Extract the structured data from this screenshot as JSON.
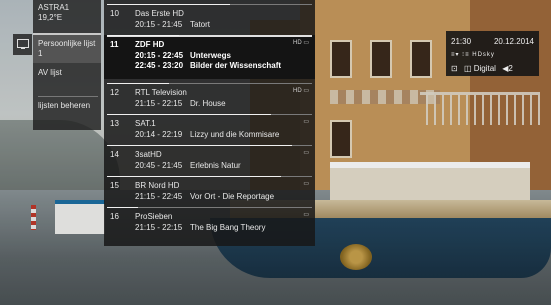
{
  "menu": {
    "satellite_name": "ASTRA1",
    "satellite_position": "19,2°E",
    "items": [
      {
        "label": "Persoonlijke lijst 1",
        "selected": true
      },
      {
        "label": "AV lijst",
        "selected": false
      },
      {
        "label": "lijsten beheren",
        "selected": false
      }
    ],
    "side_icon": "tv-icon"
  },
  "channels": [
    {
      "num": "10",
      "name": "Das Erste HD",
      "lines": [
        {
          "time": "20:15 - 21:45",
          "title": "Tatort"
        }
      ],
      "badges": "",
      "progress": 0.6
    },
    {
      "num": "11",
      "name": "ZDF HD",
      "lines": [
        {
          "time": "20:15 - 22:45",
          "title": "Unterwegs"
        },
        {
          "time": "22:45 - 23:20",
          "title": "Bilder der Wissenschaft"
        }
      ],
      "badges": "HD ▭",
      "selected": true,
      "progress": 0.35
    },
    {
      "num": "12",
      "name": "RTL Television",
      "lines": [
        {
          "time": "21:15 - 22:15",
          "title": "Dr. House"
        }
      ],
      "badges": "HD ▭",
      "progress": 0.3
    },
    {
      "num": "13",
      "name": "SAT.1",
      "lines": [
        {
          "time": "20:14 - 22:19",
          "title": "Lizzy und die Kommisare"
        }
      ],
      "badges": "▭",
      "progress": 0.8
    },
    {
      "num": "14",
      "name": "3satHD",
      "lines": [
        {
          "time": "20:45 - 21:45",
          "title": "Erlebnis Natur"
        }
      ],
      "badges": "▭",
      "progress": 0.9
    },
    {
      "num": "15",
      "name": "BR Nord HD",
      "lines": [
        {
          "time": "21:15 - 22:45",
          "title": "Vor Ort - Die Reportage"
        }
      ],
      "badges": "▭",
      "progress": 0.85
    },
    {
      "num": "16",
      "name": "ProSieben",
      "lines": [
        {
          "time": "21:15 - 22:15",
          "title": "The Big Bang Theory"
        }
      ],
      "badges": "▭",
      "progress": 0.15
    }
  ],
  "info": {
    "time": "21:30",
    "date": "20.12.2014",
    "icons_row": "≡▾ ⁝≡ HDsky",
    "bottom": [
      "⊡",
      "◫ Digital",
      "◀2"
    ]
  },
  "colors": {
    "panel": "#181818",
    "accent": "#ffffff"
  }
}
